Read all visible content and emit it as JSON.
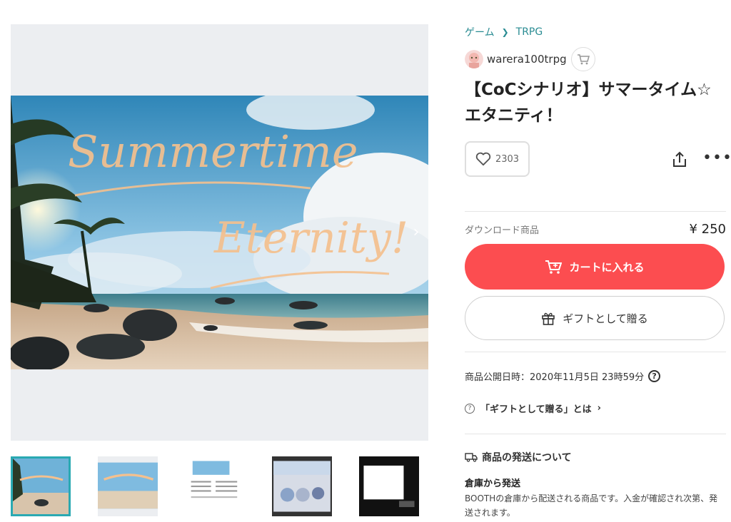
{
  "breadcrumb": {
    "category": "ゲーム",
    "subcategory": "TRPG"
  },
  "shop": {
    "name": "warera100trpg"
  },
  "product": {
    "title": "【CoCシナリオ】サマータイム☆エタニティ！",
    "likes": "2303",
    "kind": "ダウンロード商品",
    "price": "¥ 250"
  },
  "buttons": {
    "add_to_cart": "カートに入れる",
    "gift": "ギフトとして贈る"
  },
  "info": {
    "published": "商品公開日時：2020年11月5日 23時59分",
    "gift_help": "「ギフトとして贈る」とは"
  },
  "shipping": {
    "heading": "商品の発送について",
    "method": "倉庫から発送",
    "description": "BOOTHの倉庫から配送される商品です。入金が確認され次第、発送されます。"
  },
  "main_image": {
    "line1": "Summertime",
    "line2": "Eternity!"
  },
  "icons": [
    "chevron-right-icon",
    "cart-icon",
    "heart-icon",
    "share-icon",
    "more-icon",
    "gift-icon",
    "question-icon",
    "truck-icon"
  ],
  "colors": {
    "accent": "#2a8c93",
    "cart_button": "#fc4d50",
    "active_thumb_border": "#2aa9b2"
  }
}
